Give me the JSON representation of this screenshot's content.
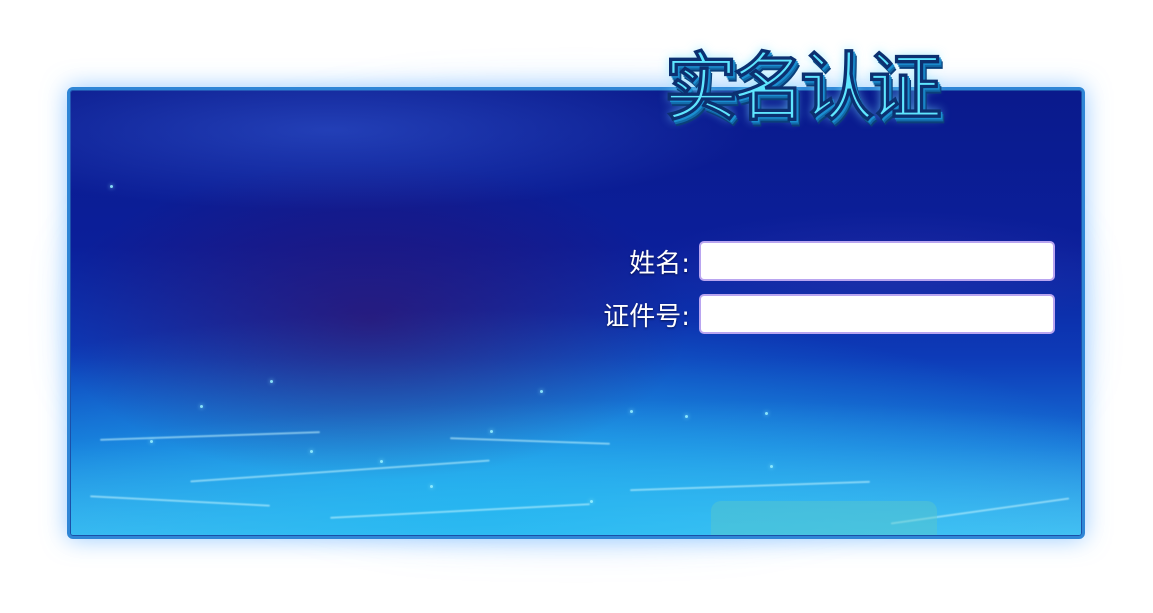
{
  "dialog": {
    "title": "实名认证"
  },
  "form": {
    "name_label": "姓名:",
    "name_value": "",
    "id_label": "证件号:",
    "id_value": ""
  },
  "colors": {
    "panel_border": "#2f86d6",
    "panel_top": "#0a1a8c",
    "panel_bottom": "#3fb6ee",
    "title_color": "#5fe6ff",
    "label_color": "#ffffff",
    "input_border": "#b9a5f0"
  }
}
